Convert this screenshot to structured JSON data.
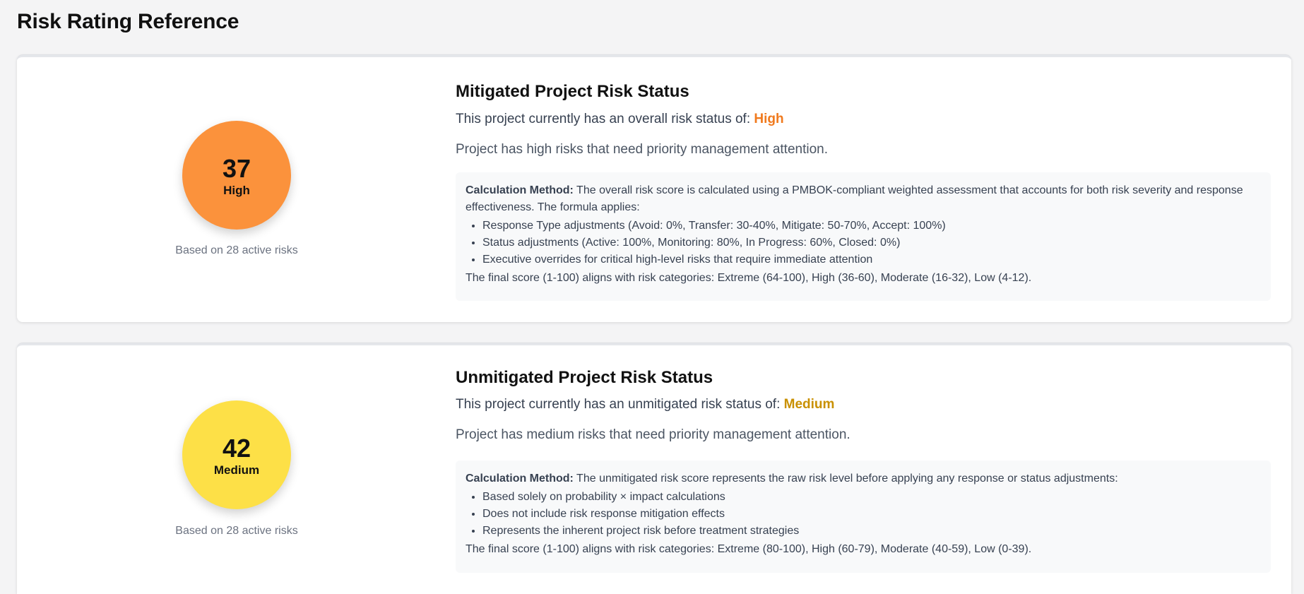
{
  "page": {
    "title": "Risk Rating Reference"
  },
  "colors": {
    "high_circle": "#fb923c",
    "medium_circle": "#fde047",
    "high_text": "#f07a1e",
    "medium_text": "#c99000"
  },
  "mitigated": {
    "score": "37",
    "level": "High",
    "active_note": "Based on 28 active risks",
    "title": "Mitigated Project Risk Status",
    "status_prefix": "This project currently has an overall risk status of:",
    "status_value": "High",
    "description": "Project has high risks that need priority management attention.",
    "calc_label": "Calculation Method:",
    "calc_text": "The overall risk score is calculated using a PMBOK-compliant weighted assessment that accounts for both risk severity and response effectiveness. The formula applies:",
    "calc_items": [
      "Response Type adjustments (Avoid: 0%, Transfer: 30-40%, Mitigate: 50-70%, Accept: 100%)",
      "Status adjustments (Active: 100%, Monitoring: 80%, In Progress: 60%, Closed: 0%)",
      "Executive overrides for critical high-level risks that require immediate attention"
    ],
    "calc_final": "The final score (1-100) aligns with risk categories: Extreme (64-100), High (36-60), Moderate (16-32), Low (4-12)."
  },
  "unmitigated": {
    "score": "42",
    "level": "Medium",
    "active_note": "Based on 28 active risks",
    "title": "Unmitigated Project Risk Status",
    "status_prefix": "This project currently has an unmitigated risk status of:",
    "status_value": "Medium",
    "description": "Project has medium risks that need priority management attention.",
    "calc_label": "Calculation Method:",
    "calc_text": "The unmitigated risk score represents the raw risk level before applying any response or status adjustments:",
    "calc_items": [
      "Based solely on probability × impact calculations",
      "Does not include risk response mitigation effects",
      "Represents the inherent project risk before treatment strategies"
    ],
    "calc_final": "The final score (1-100) aligns with risk categories: Extreme (80-100), High (60-79), Moderate (40-59), Low (0-39)."
  }
}
